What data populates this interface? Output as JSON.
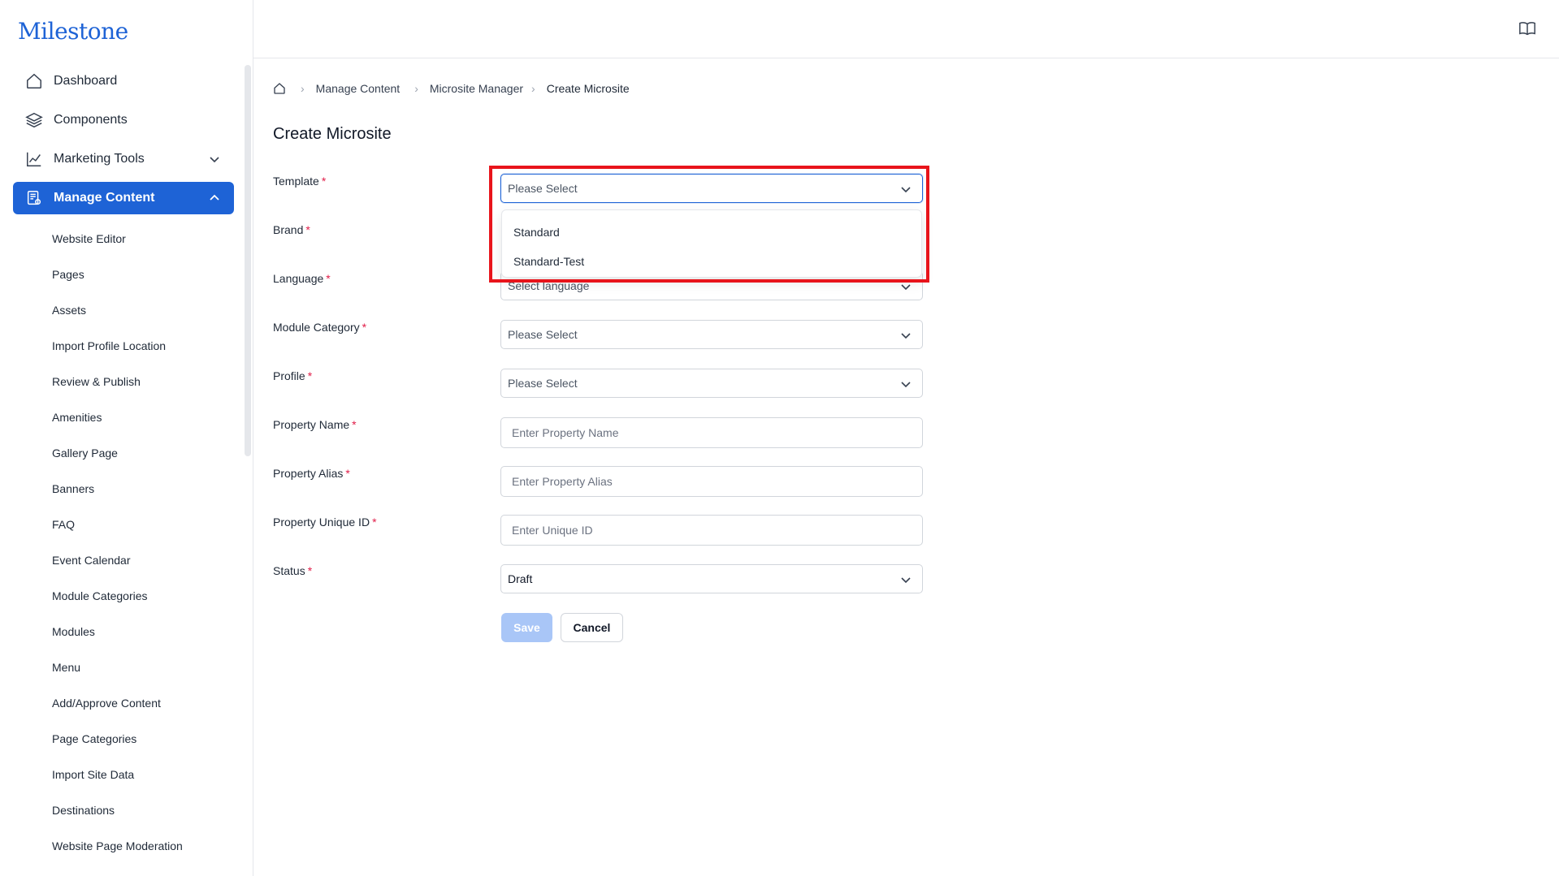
{
  "app": {
    "logo": "Milestone"
  },
  "sidebar": {
    "top_items": [
      {
        "label": "Dashboard",
        "icon": "home-icon"
      },
      {
        "label": "Components",
        "icon": "layers-icon"
      },
      {
        "label": "Marketing Tools",
        "icon": "chart-line-icon",
        "expanded": false
      },
      {
        "label": "Manage Content",
        "icon": "document-gear-icon",
        "expanded": true,
        "active": true
      }
    ],
    "sub_items": [
      "Website Editor",
      "Pages",
      "Assets",
      "Import Profile Location",
      "Review & Publish",
      "Amenities",
      "Gallery Page",
      "Banners",
      "FAQ",
      "Event Calendar",
      "Module Categories",
      "Modules",
      "Menu",
      "Add/Approve Content",
      "Page Categories",
      "Import Site Data",
      "Destinations",
      "Website Page Moderation"
    ]
  },
  "header": {
    "icon": "book-icon"
  },
  "breadcrumb": {
    "home_icon": "home-icon",
    "items": [
      "Manage Content",
      "Microsite Manager",
      "Create Microsite"
    ]
  },
  "page": {
    "title": "Create Microsite"
  },
  "form": {
    "required_mark": "*",
    "template": {
      "label": "Template",
      "value": "Please Select",
      "options": [
        "Standard",
        "Standard-Test"
      ],
      "open": true
    },
    "brand": {
      "label": "Brand"
    },
    "language": {
      "label": "Language",
      "value": "Select language"
    },
    "module_category": {
      "label": "Module Category",
      "value": "Please Select"
    },
    "profile": {
      "label": "Profile",
      "value": "Please Select"
    },
    "property_name": {
      "label": "Property Name",
      "placeholder": "Enter Property Name"
    },
    "property_alias": {
      "label": "Property Alias",
      "placeholder": "Enter Property Alias"
    },
    "property_unique_id": {
      "label": "Property Unique ID",
      "placeholder": "Enter Unique ID"
    },
    "status": {
      "label": "Status",
      "value": "Draft"
    },
    "save_label": "Save",
    "cancel_label": "Cancel"
  },
  "colors": {
    "primary": "#1e63d6",
    "required": "#e11d48",
    "highlight": "#e8141b",
    "save_disabled": "#a9c6f7"
  }
}
